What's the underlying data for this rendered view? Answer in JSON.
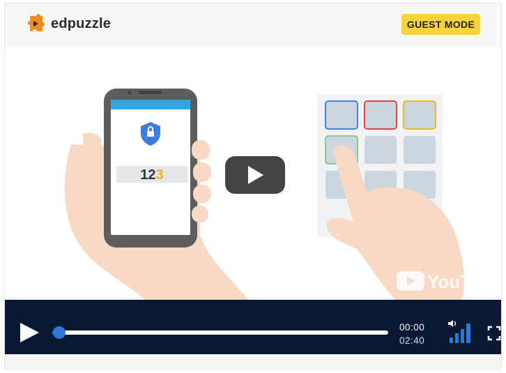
{
  "header": {
    "logo_text": "edpuzzle",
    "guest_mode_label": "GUEST MODE"
  },
  "video": {
    "phone_code_digits": "12",
    "phone_code_highlight": "3",
    "watermark_text": "YouTube"
  },
  "player": {
    "current_time": "00:00",
    "duration": "02:40",
    "progress": 0.02,
    "volume_level": 1.0
  },
  "colors": {
    "accent": "#2a7bd9",
    "controls_bg": "#0b1833",
    "guest_badge": "#f7d33b",
    "logo_orange": "#f28c1c"
  },
  "icons": {
    "logo": "puzzle-icon",
    "play": "play-icon",
    "center_play": "youtube-play-icon",
    "volume": "volume-icon",
    "fullscreen": "fullscreen-icon"
  }
}
